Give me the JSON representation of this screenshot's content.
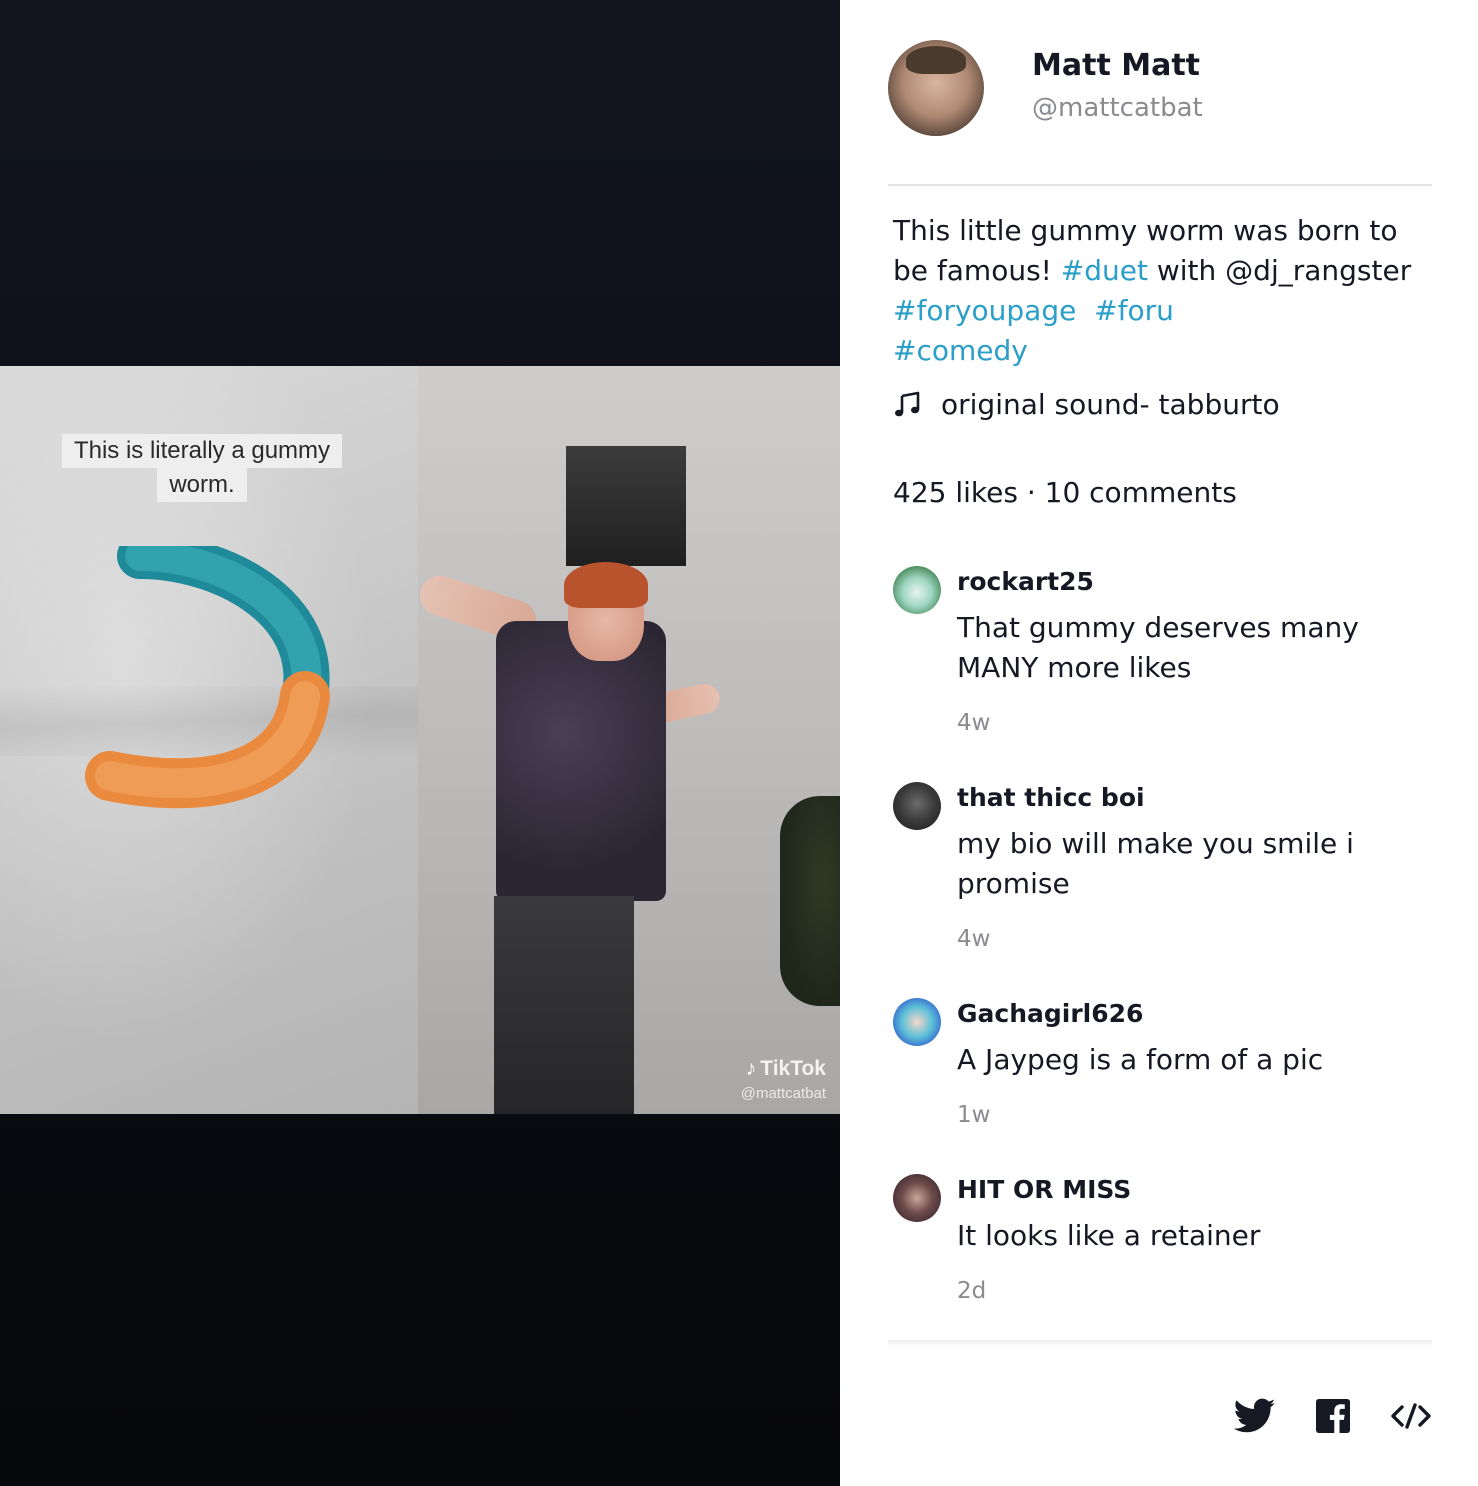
{
  "video": {
    "caption_line1": "This is literally a gummy",
    "caption_line2": "worm.",
    "watermark_brand": "TikTok",
    "watermark_user": "@mattcatbat"
  },
  "author": {
    "name": "Matt Matt",
    "handle": "@mattcatbat"
  },
  "description": {
    "text1": "This little gummy worm was born to be famous! ",
    "tag_duet": "#duet",
    "text2": "  with @dj_rangster ",
    "tag_foryoupage": "#foryoupage",
    "tag_foru": "#foru",
    "tag_comedy": "#comedy"
  },
  "sound": {
    "label": "original sound- tabburto",
    "icon": "music-note-icon"
  },
  "stats": {
    "text": "425 likes · 10 comments"
  },
  "comments": [
    {
      "user": "rockart25",
      "text": "That gummy deserves many MANY more likes",
      "time": "4w"
    },
    {
      "user": "that thicc boi",
      "text": "my bio will make you smile i promise",
      "time": "4w"
    },
    {
      "user": "Gachagirl626",
      "text": "A Jaypeg is a form of a pic",
      "time": "1w"
    },
    {
      "user": "HIT OR MISS",
      "text": "It looks like a retainer",
      "time": "2d"
    }
  ],
  "share": {
    "icons": [
      "twitter-icon",
      "facebook-icon",
      "embed-code-icon"
    ]
  },
  "colors": {
    "hashtag": "#2b9fc9",
    "text": "#161823",
    "muted": "#8a8b91",
    "video_bg": "#121520"
  }
}
